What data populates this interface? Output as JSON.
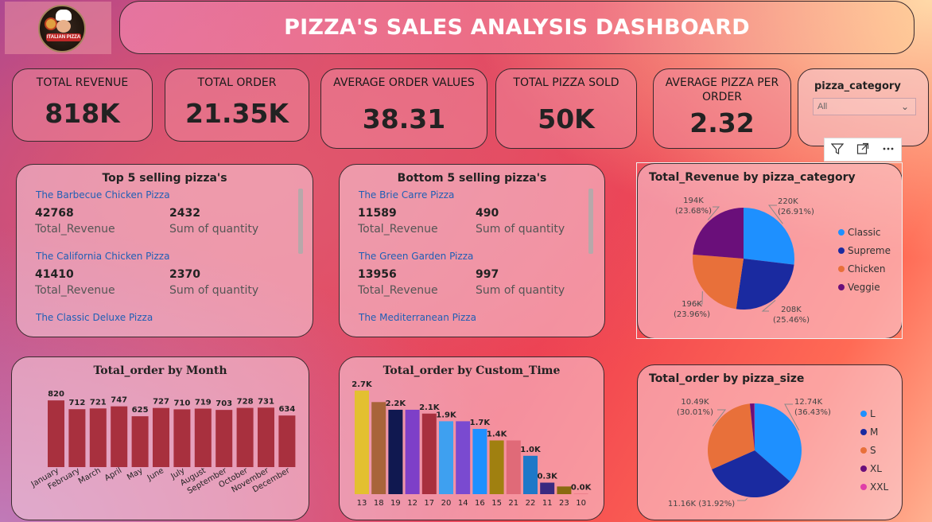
{
  "header": {
    "title": "PIZZA'S SALES ANALYSIS DASHBOARD",
    "logo_text": "ITALIAN PIZZA"
  },
  "kpis": [
    {
      "label": "TOTAL REVENUE",
      "value": "818K"
    },
    {
      "label": "TOTAL ORDER",
      "value": "21.35K"
    },
    {
      "label": "AVERAGE ORDER VALUES",
      "value": "38.31"
    },
    {
      "label": "TOTAL PIZZA SOLD",
      "value": "50K"
    },
    {
      "label": "AVERAGE PIZZA PER ORDER",
      "value": "2.32"
    }
  ],
  "filter": {
    "label": "pizza_category",
    "selected": "All"
  },
  "toolbar": {
    "icons": [
      "filter-icon",
      "focus-mode-icon",
      "more-options-icon"
    ]
  },
  "top5": {
    "title": "Top 5 selling pizza's",
    "items": [
      {
        "name": "The Barbecue Chicken Pizza",
        "revenue": "42768",
        "quantity": "2432"
      },
      {
        "name": "The California Chicken Pizza",
        "revenue": "41410",
        "quantity": "2370"
      },
      {
        "name": "The Classic Deluxe Pizza"
      }
    ],
    "revenue_caption": "Total_Revenue",
    "quantity_caption": "Sum of quantity"
  },
  "bottom5": {
    "title": "Bottom 5 selling pizza's",
    "items": [
      {
        "name": "The Brie Carre Pizza",
        "revenue": "11589",
        "quantity": "490"
      },
      {
        "name": "The Green Garden Pizza",
        "revenue": "13956",
        "quantity": "997"
      },
      {
        "name": "The Mediterranean Pizza"
      }
    ],
    "revenue_caption": "Total_Revenue",
    "quantity_caption": "Sum of quantity"
  },
  "chart_data": [
    {
      "type": "pie",
      "title": "Total_Revenue by pizza_category",
      "categories": [
        "Classic",
        "Supreme",
        "Chicken",
        "Veggie"
      ],
      "values": [
        220,
        208,
        196,
        194
      ],
      "labels": [
        [
          "220K",
          "(26.91%)"
        ],
        [
          "208K",
          "(25.46%)"
        ],
        [
          "196K",
          "(23.96%)"
        ],
        [
          "194K",
          "(23.68%)"
        ]
      ],
      "colors": [
        "#1e90ff",
        "#1a2aa0",
        "#e8703a",
        "#6a0f7a"
      ],
      "legend": "right"
    },
    {
      "type": "pie",
      "title": "Total_order by pizza_size",
      "categories": [
        "L",
        "M",
        "S",
        "XL",
        "XXL"
      ],
      "values": [
        12.74,
        11.16,
        10.49,
        0.54,
        0.03
      ],
      "labels": [
        [
          "12.74K",
          "(36.43%)"
        ],
        [
          "11.16K (31.92%)"
        ],
        [
          "10.49K",
          "(30.01%)"
        ],
        [],
        []
      ],
      "colors": [
        "#1e90ff",
        "#1a2aa0",
        "#e8703a",
        "#6a0f7a",
        "#e03fa8"
      ],
      "legend": "right"
    },
    {
      "type": "bar",
      "title": "Total_order by Month",
      "categories": [
        "January",
        "February",
        "March",
        "April",
        "May",
        "June",
        "July",
        "August",
        "September",
        "October",
        "November",
        "December"
      ],
      "values": [
        820,
        712,
        721,
        747,
        625,
        727,
        710,
        719,
        703,
        728,
        731,
        634
      ],
      "value_labels": [
        "820",
        "712",
        "721",
        "747",
        "625",
        "727",
        "710",
        "719",
        "703",
        "728",
        "731",
        "634"
      ],
      "color": "#a8303e",
      "ylim": [
        0,
        900
      ]
    },
    {
      "type": "bar",
      "title": "Total_order by Custom_Time",
      "categories": [
        "13",
        "18",
        "19",
        "12",
        "17",
        "20",
        "14",
        "16",
        "15",
        "21",
        "22",
        "11",
        "23",
        "10"
      ],
      "values": [
        2700,
        2400,
        2200,
        2200,
        2100,
        1900,
        1900,
        1700,
        1400,
        1400,
        1000,
        300,
        200,
        10
      ],
      "value_labels": [
        "2.7K",
        "",
        "2.2K",
        "",
        "2.1K",
        "1.9K",
        "",
        "1.7K",
        "1.4K",
        "",
        "1.0K",
        "0.3K",
        "",
        "0.0K"
      ],
      "colors": [
        "#e3c030",
        "#a8643a",
        "#101850",
        "#7e3fc8",
        "#a8303e",
        "#3ea0f0",
        "#7a4ad0",
        "#1e90ff",
        "#a08010",
        "#e06a78",
        "#1e78c8",
        "#3a2a80",
        "#8a6a10",
        "#e06a78"
      ],
      "ylim": [
        0,
        2800
      ]
    }
  ]
}
